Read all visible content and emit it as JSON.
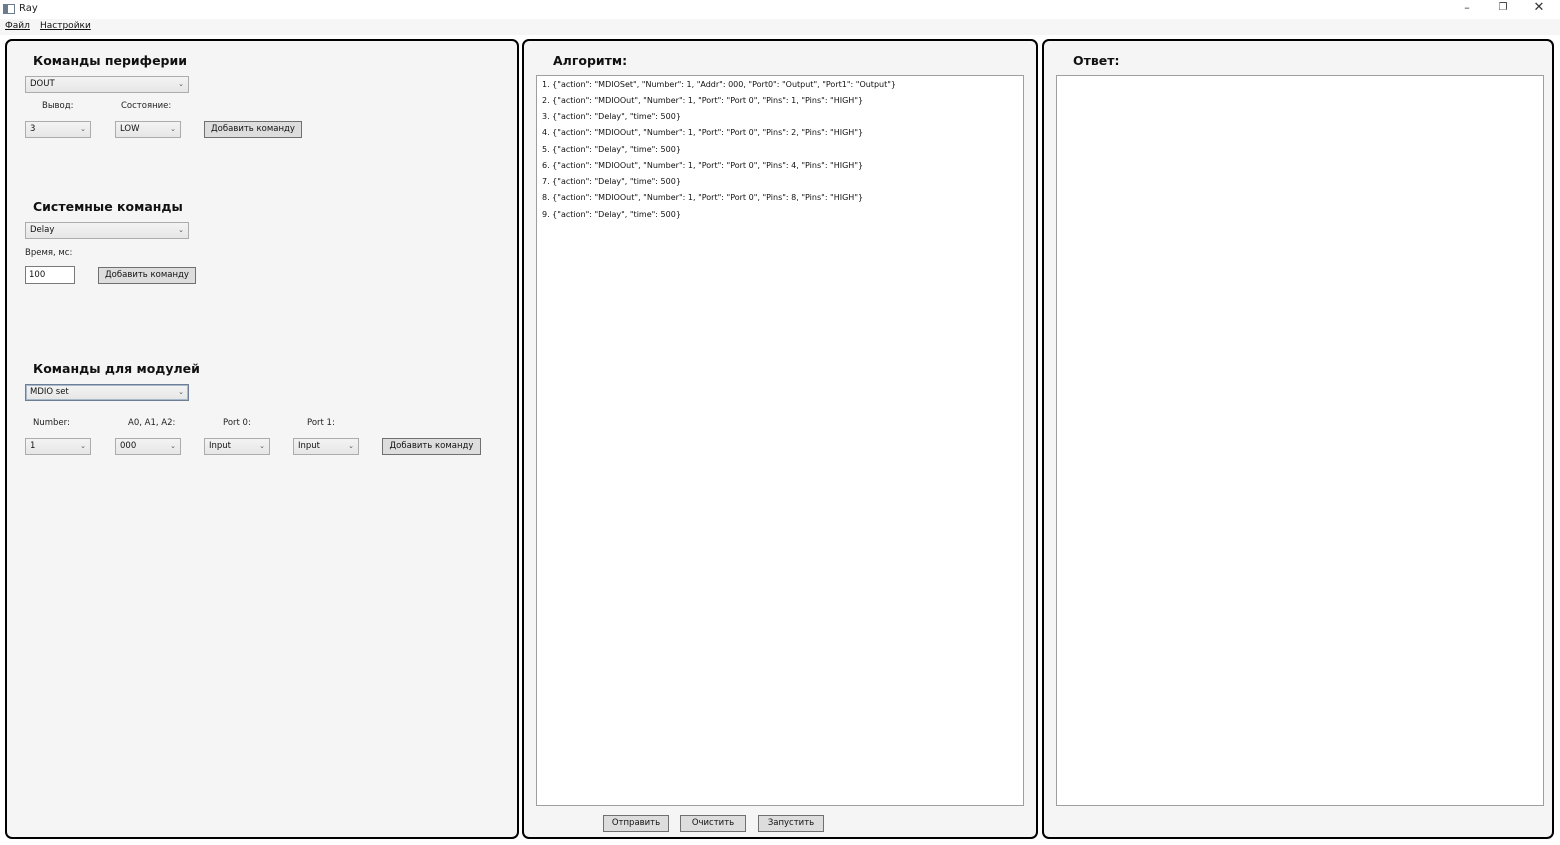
{
  "window": {
    "title": "Ray",
    "minimize": "–",
    "restore": "❐",
    "close": "✕"
  },
  "menu": {
    "file": "Файл",
    "settings": "Настройки"
  },
  "peripheral": {
    "heading": "Команды периферии",
    "command_value": "DOUT",
    "pin_label": "Вывод:",
    "state_label": "Состояние:",
    "pin_value": "3",
    "state_value": "LOW",
    "add_button": "Добавить команду"
  },
  "system": {
    "heading": "Системные команды",
    "command_value": "Delay",
    "time_label": "Время, мс:",
    "time_value": "100",
    "add_button": "Добавить команду"
  },
  "modules": {
    "heading": "Команды для модулей",
    "command_value": "MDIO set",
    "number_label": "Number:",
    "addr_label": "A0, A1, A2:",
    "port0_label": "Port 0:",
    "port1_label": "Port 1:",
    "number_value": "1",
    "addr_value": "000",
    "port0_value": "Input",
    "port1_value": "Input",
    "add_button": "Добавить команду"
  },
  "algorithm": {
    "heading": "Алгоритм:",
    "lines": [
      "1. {\"action\": \"MDIOSet\", \"Number\": 1, \"Addr\": 000, \"Port0\": \"Output\", \"Port1\": \"Output\"}",
      "2. {\"action\": \"MDIOOut\", \"Number\": 1, \"Port\":  \"Port 0\", \"Pins\": 1, \"Pins\": \"HIGH\"}",
      "3. {\"action\": \"Delay\", \"time\": 500}",
      "4. {\"action\": \"MDIOOut\", \"Number\": 1, \"Port\":  \"Port 0\", \"Pins\": 2, \"Pins\": \"HIGH\"}",
      "5. {\"action\": \"Delay\", \"time\": 500}",
      "6. {\"action\": \"MDIOOut\", \"Number\": 1, \"Port\":  \"Port 0\", \"Pins\": 4, \"Pins\": \"HIGH\"}",
      "7. {\"action\": \"Delay\", \"time\": 500}",
      "8. {\"action\": \"MDIOOut\", \"Number\": 1, \"Port\":  \"Port 0\", \"Pins\": 8, \"Pins\": \"HIGH\"}",
      "9. {\"action\": \"Delay\", \"time\": 500}"
    ],
    "send_button": "Отправить",
    "clear_button": "Очистить",
    "run_button": "Запустить"
  },
  "response": {
    "heading": "Ответ:"
  },
  "icons": {
    "dropdown": "chevron-down-icon",
    "app": "app-window-icon"
  }
}
